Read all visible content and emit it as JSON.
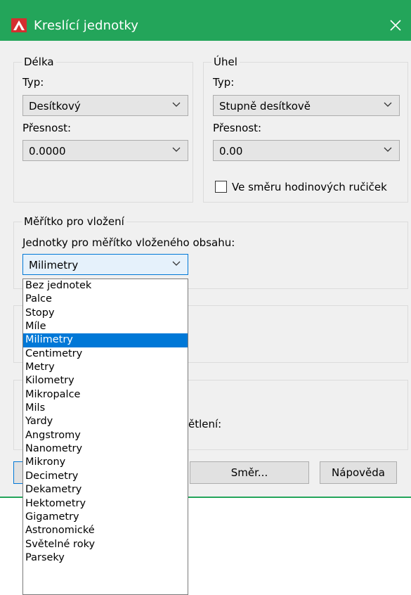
{
  "window": {
    "title": "Kreslící jednotky"
  },
  "length": {
    "group_label": "Délka",
    "type_label": "Typ:",
    "type_value": "Desítkový",
    "precision_label": "Přesnost:",
    "precision_value": "0.0000"
  },
  "angle": {
    "group_label": "Úhel",
    "type_label": "Typ:",
    "type_value": "Stupně desítkově",
    "precision_label": "Přesnost:",
    "precision_value": "0.00",
    "clockwise_label": "Ve směru hodinových ručiček"
  },
  "insert_scale": {
    "group_label": "Měřítko pro vložení",
    "units_label": "Jednotky pro měřítko vloženého obsahu:",
    "units_value": "Milimetry",
    "options": [
      "Bez jednotek",
      "Palce",
      "Stopy",
      "Míle",
      "Milimetry",
      "Centimetry",
      "Metry",
      "Kilometry",
      "Mikropalce",
      "Mils",
      "Yardy",
      "Angstromy",
      "Nanometry",
      "Mikrony",
      "Decimetry",
      "Dekametry",
      "Hektometry",
      "Gigametry",
      "Astronomické",
      "Světelné roky",
      "Parseky"
    ],
    "selected_index": 4
  },
  "lighting": {
    "partial_label": "ětlení:"
  },
  "buttons": {
    "direction": "Směr...",
    "help": "Nápověda"
  },
  "colors": {
    "title_bar": "#23a55a",
    "selection": "#0078d7"
  }
}
